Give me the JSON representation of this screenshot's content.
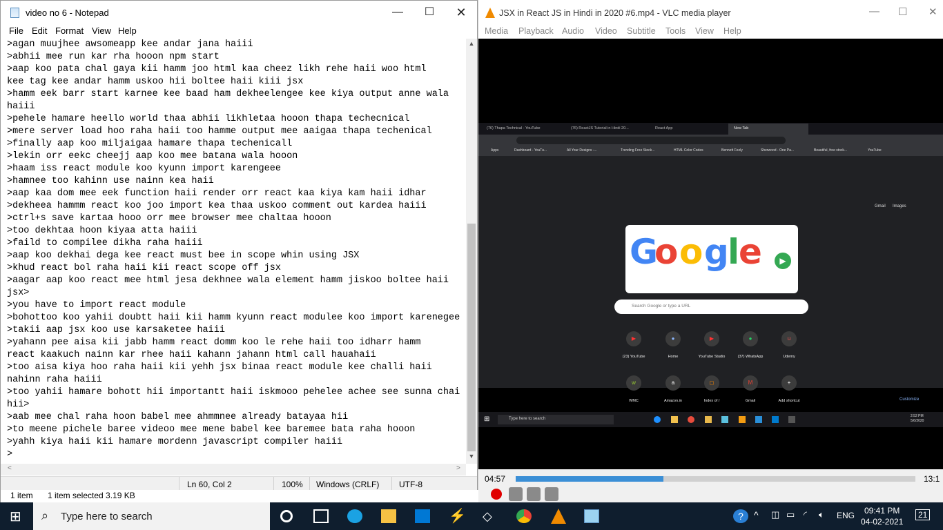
{
  "notepad": {
    "title": "video no 6 - Notepad",
    "menu": [
      "File",
      "Edit",
      "Format",
      "View",
      "Help"
    ],
    "lines": [
      ">agan muujhee awsomeapp kee andar jana haiii",
      ">abhii mee run kar rha hooon npm start",
      ">aap koo pata chal gaya kii hamm joo html kaa cheez likh rehe haii woo html",
      "kee tag kee andar hamm uskoo hii boltee haii kiii jsx",
      ">hamm eek barr start karnee kee baad ham dekheelengee kee kiya output anne wala",
      "haiii",
      ">pehele hamare heello world thaa abhii likhletaa hooon thapa techecnical",
      ">mere server load hoo raha haii too hamme output mee aaigaa thapa techenical",
      ">finally aap koo miljaigaa hamare thapa techenicall",
      ">lekin orr eekc cheejj aap koo mee batana wala hooon",
      ">haam iss react module koo kyunn import karengeee",
      ">hamnee too kahinn use nainn kea haii",
      ">aap kaa dom mee eek function haii render orr react kaa kiya kam haii idhar",
      ">dekheea hammm react koo joo import kea thaa uskoo comment out kardea haiii",
      ">ctrl+s save kartaa hooo orr mee browser mee chaltaa hooon",
      ">too dekhtaa hoon kiyaa atta haiii",
      ">faild to compilee dikha raha haiii",
      ">aap koo dekhai dega kee react must bee in scope whin using JSX",
      ">khud react bol raha haii kii react scope off jsx",
      ">aagar aap koo react mee html jesa dekhnee wala element hamm jiskoo boltee haii",
      "jsx>",
      ">you have to import react module",
      ">bohottoo koo yahii doubtt haii kii hamm kyunn react modulee koo import karenegee",
      ">takii aap jsx koo use karsaketee haiii",
      ">yahann pee aisa kii jabb hamm react domm koo le rehe haii too idharr hamm",
      "react kaakuch nainn kar rhee haii kahann jahann html call hauahaii",
      ">too aisa kiya hoo raha haii kii yehh jsx binaa react module kee challi haii",
      "nahinn raha haiii",
      ">too yahii hamare bohott hii importantt haii iskmooo pehelee achee see sunna chai",
      "hii>",
      ">aab mee chal raha hoon babel mee ahmmnee already batayaa hii",
      ">to meene pichele baree videoo mee mene babel kee baremee bata raha hooon",
      ">yahh kiya haii kii hamare mordenn javascript compiler haiii",
      ">"
    ],
    "status": {
      "position": "Ln 60, Col 2",
      "zoom": "100%",
      "line_ending": "Windows (CRLF)",
      "encoding": "UTF-8"
    }
  },
  "explorer": {
    "items": "1 item",
    "selected": "1 item selected  3.19 KB"
  },
  "vlc": {
    "title": "JSX in React JS in Hindi in 2020 #6.mp4 - VLC media player",
    "menu": [
      "Media",
      "Playback",
      "Audio",
      "Video",
      "Subtitle",
      "Tools",
      "View",
      "Help"
    ],
    "time_elapsed": "04:57",
    "time_total": "13:1",
    "progress": 0.37
  },
  "video_frame": {
    "tabs": [
      "(76) Thapa Technical - YouTube",
      "(76) ReactJS Tutorial in Hindi 20...",
      "React App",
      "New Tab"
    ],
    "bookmarks": [
      "Apps",
      "Dashboard - YouTu...",
      "All Your Designs -...",
      "Trending Free Stock...",
      "HTML Color Codes",
      "Bennett Feely",
      "Sherwood - One Pa...",
      "Beautiful, free stock...",
      "YouTube"
    ],
    "top_links": [
      "Gmail",
      "Images"
    ],
    "search_placeholder": "Search Google or type a URL",
    "shortcuts_row1": [
      "(23) YouTube",
      "Home",
      "YouTube Studio",
      "(37) WhatsApp",
      "Udemy"
    ],
    "shortcuts_row2": [
      "WMC",
      "Amazon.in",
      "Index of /",
      "Gmail",
      "Add shortcut"
    ],
    "customize": "Customize",
    "taskbar_search": "Type here to search",
    "clock_time": "2:52 PM",
    "clock_date": "5/6/2020"
  },
  "taskbar": {
    "search_placeholder": "Type here to search",
    "language": "ENG",
    "time": "09:41 PM",
    "date": "04-02-2021",
    "notifications": "21"
  }
}
